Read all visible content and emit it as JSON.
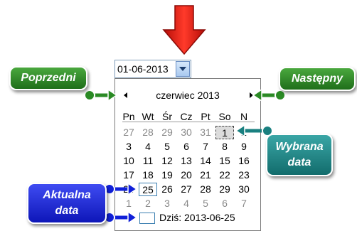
{
  "date_input": {
    "value": "01-06-2013"
  },
  "calendar": {
    "month_label": "czerwiec 2013",
    "weekdays": [
      "Pn",
      "Wt",
      "Śr",
      "Cz",
      "Pt",
      "So",
      "N"
    ],
    "weeks": [
      [
        "27",
        "28",
        "29",
        "30",
        "31",
        "1",
        "2"
      ],
      [
        "3",
        "4",
        "5",
        "6",
        "7",
        "8",
        "9"
      ],
      [
        "10",
        "11",
        "12",
        "13",
        "14",
        "15",
        "16"
      ],
      [
        "17",
        "18",
        "19",
        "20",
        "21",
        "22",
        "23"
      ],
      [
        "24",
        "25",
        "26",
        "27",
        "28",
        "29",
        "30"
      ],
      [
        "1",
        "2",
        "3",
        "4",
        "5",
        "6",
        "7"
      ]
    ],
    "today_label": "Dziś: 2013-06-25"
  },
  "callouts": {
    "previous": "Poprzedni",
    "next": "Następny",
    "selected_line1": "Wybrana",
    "selected_line2": "data",
    "current_line1": "Aktualna",
    "current_line2": "data"
  },
  "colors": {
    "arrow": "#e8241c",
    "green": "#2a8a24",
    "teal": "#1a8080",
    "blue": "#1020d8"
  },
  "icons": [
    "down-arrow-icon",
    "dropdown-arrow-icon",
    "previous-month-icon",
    "next-month-icon"
  ]
}
